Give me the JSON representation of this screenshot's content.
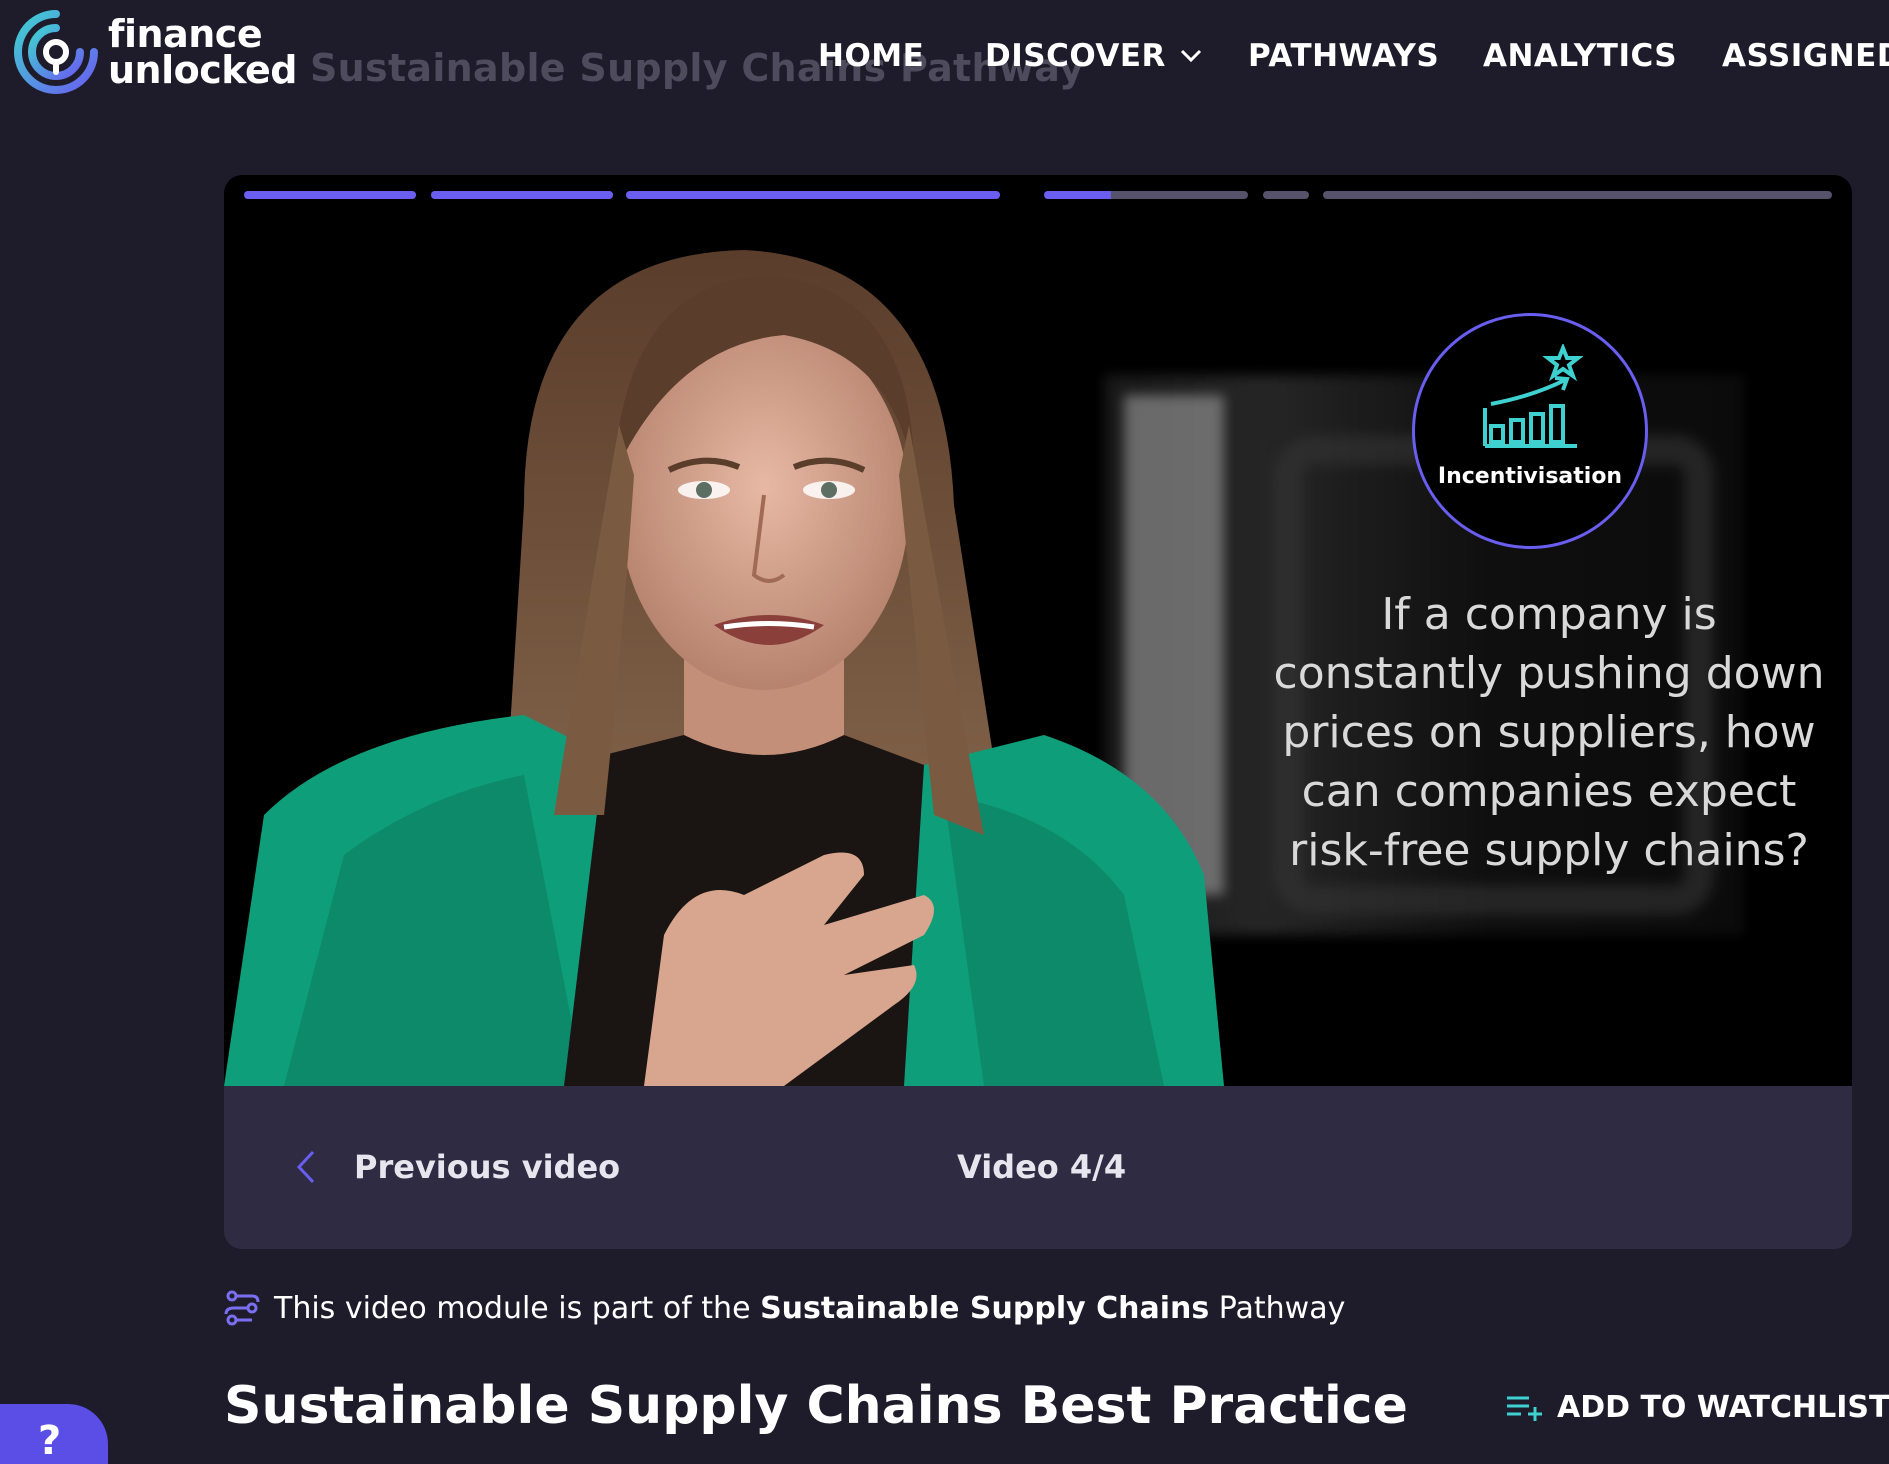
{
  "header": {
    "logo_line1": "finance",
    "logo_line2": "unlocked",
    "faded_title": "Sustainable Supply Chains Pathway",
    "nav": {
      "home": "HOME",
      "discover": "DISCOVER",
      "pathways": "PATHWAYS",
      "analytics": "ANALYTICS",
      "assigned": "ASSIGNED I"
    }
  },
  "player": {
    "progress_segments": [
      1,
      1,
      1,
      0.33,
      0,
      0,
      0
    ],
    "badge_label": "Incentivisation",
    "quote": "If a company is constantly pushing down prices on suppliers, how can companies expect risk-free supply chains?",
    "prev_label": "Previous video",
    "counter": "Video 4/4"
  },
  "pathway_note": {
    "prefix": "This video module is part of the",
    "pathway_name": "Sustainable Supply Chains",
    "suffix": "Pathway"
  },
  "page_title": "Sustainable Supply Chains Best Practice",
  "watchlist_label": "ADD TO WATCHLIST",
  "help_label": "?",
  "colors": {
    "background": "#1e1c2b",
    "panel": "#2e2b42",
    "accent": "#6a5ef0",
    "teal": "#3fd1d0"
  },
  "icons": [
    "chevron-down-icon",
    "chevron-left-icon",
    "pathway-icon",
    "playlist-add-icon",
    "trophy-chart-icon"
  ]
}
